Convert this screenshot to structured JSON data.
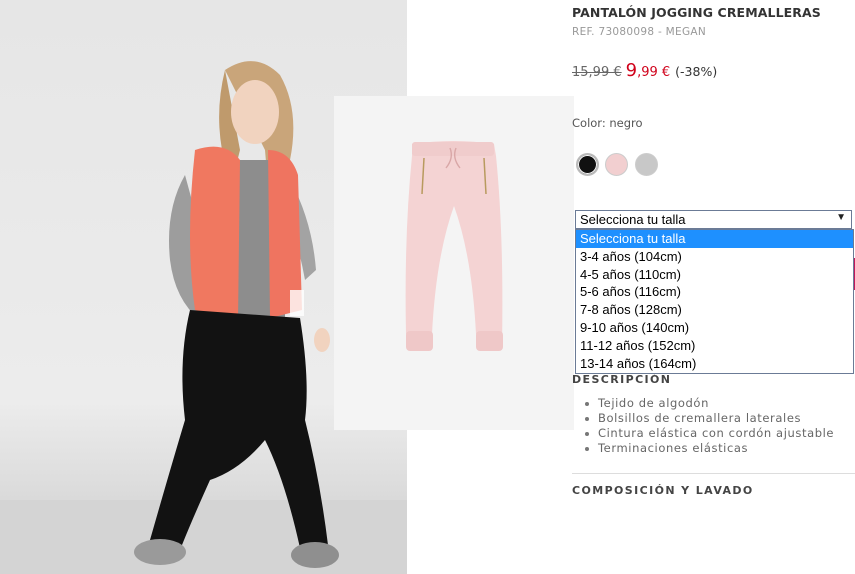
{
  "product": {
    "title": "PANTALÓN JOGGING CREMALLERAS",
    "ref": "REF. 73080098 - MEGAN",
    "old_price": "15,99 €",
    "new_price_int": "9",
    "new_price_dec": ",99 €",
    "discount": "(-38%)"
  },
  "color": {
    "label": "Color: negro",
    "swatches": [
      {
        "name": "negro",
        "hex": "#111111"
      },
      {
        "name": "rosa",
        "hex": "#f2cfd0"
      },
      {
        "name": "gris",
        "hex": "#c8c8c8"
      }
    ]
  },
  "size_select": {
    "selected": "Selecciona tu talla",
    "options": [
      "Selecciona tu talla",
      "3-4 años (104cm)",
      "4-5 años (110cm)",
      "5-6 años (116cm)",
      "7-8 años (128cm)",
      "9-10 años (140cm)",
      "11-12 años (152cm)",
      "13-14 años (164cm)"
    ]
  },
  "description": {
    "heading": "DESCRIPCIÓN",
    "items": [
      "Tejido de algodón",
      "Bolsillos de cremallera laterales",
      "Cintura elástica con cordón ajustable",
      "Terminaciones elásticas"
    ]
  },
  "composition": {
    "heading": "COMPOSICIÓN Y LAVADO"
  },
  "colors": {
    "accent_red": "#d0021b",
    "highlight": "#1e90ff",
    "brand_pink": "#c2185b"
  }
}
